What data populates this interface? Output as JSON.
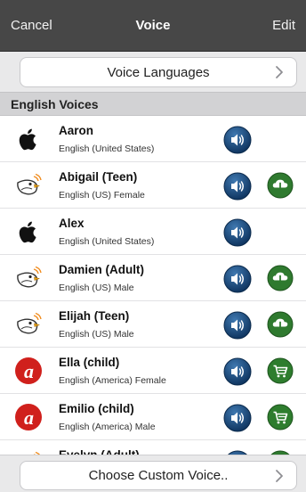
{
  "nav": {
    "cancel": "Cancel",
    "title": "Voice",
    "edit": "Edit"
  },
  "languages_button": "Voice Languages",
  "section": "English Voices",
  "voices": [
    {
      "name": "Aaron",
      "desc": "English (United States)",
      "avatar": "apple-icon",
      "action": "none"
    },
    {
      "name": "Abigail (Teen)",
      "desc": "English (US) Female",
      "avatar": "bird-icon",
      "action": "download-icon"
    },
    {
      "name": "Alex",
      "desc": "English (United States)",
      "avatar": "apple-icon",
      "action": "none"
    },
    {
      "name": "Damien (Adult)",
      "desc": "English (US) Male",
      "avatar": "bird-icon",
      "action": "download-icon"
    },
    {
      "name": "Elijah (Teen)",
      "desc": "English (US) Male",
      "avatar": "bird-icon",
      "action": "download-icon"
    },
    {
      "name": "Ella (child)",
      "desc": "English (America) Female",
      "avatar": "acapela-icon",
      "action": "cart-icon"
    },
    {
      "name": "Emilio (child)",
      "desc": "English (America) Male",
      "avatar": "acapela-icon",
      "action": "cart-icon"
    },
    {
      "name": "Evelyn (Adult)",
      "desc": "",
      "avatar": "bird-icon",
      "action": "download-icon"
    }
  ],
  "custom_button": "Choose Custom Voice..",
  "colors": {
    "navbar": "#474747",
    "speaker": "#1d4b7a",
    "download": "#2f7a2f",
    "cart": "#2e7d2e",
    "acapela": "#d0201c"
  }
}
